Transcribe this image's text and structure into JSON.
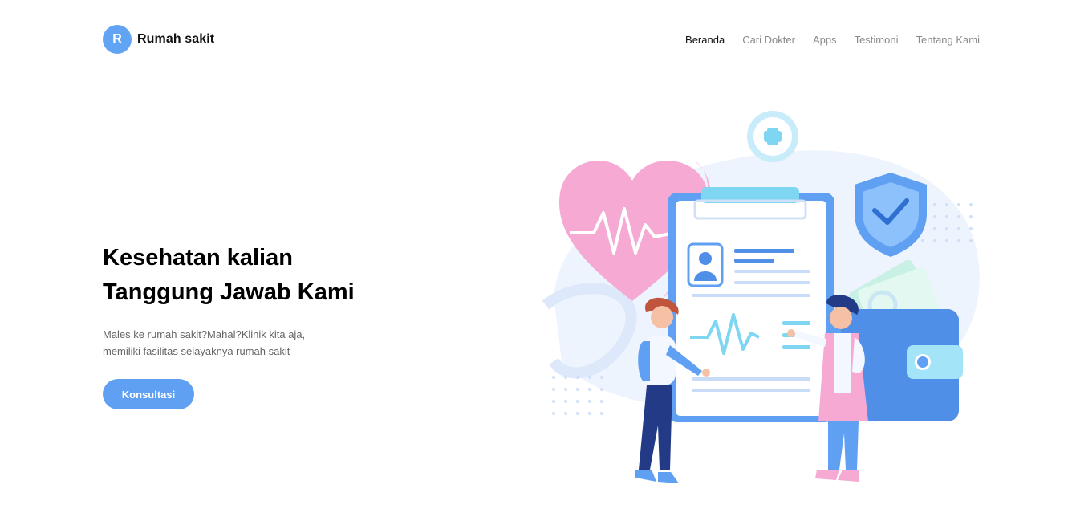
{
  "brand": {
    "initial": "R",
    "name": "Rumah sakit"
  },
  "nav": {
    "items": [
      {
        "label": "Beranda",
        "active": true
      },
      {
        "label": "Cari Dokter",
        "active": false
      },
      {
        "label": "Apps",
        "active": false
      },
      {
        "label": "Testimoni",
        "active": false
      },
      {
        "label": "Tentang Kami",
        "active": false
      }
    ]
  },
  "hero": {
    "title_line1": "Kesehatan kalian",
    "title_line2": "Tanggung Jawab Kami",
    "desc_line1": "Males ke rumah sakit?Mahal?Klinik kita aja,",
    "desc_line2": "memiliki fasilitas selayaknya rumah sakit",
    "cta_label": "Konsultasi"
  },
  "colors": {
    "accent": "#5fa0f3",
    "heart": "#f4a2cf",
    "clipboard": "#5fa0f3",
    "shield": "#5fa0f3"
  },
  "icons": [
    "plus-icon",
    "heart-icon",
    "shield-check-icon",
    "wallet-icon",
    "doctor-icon",
    "patient-icon"
  ]
}
